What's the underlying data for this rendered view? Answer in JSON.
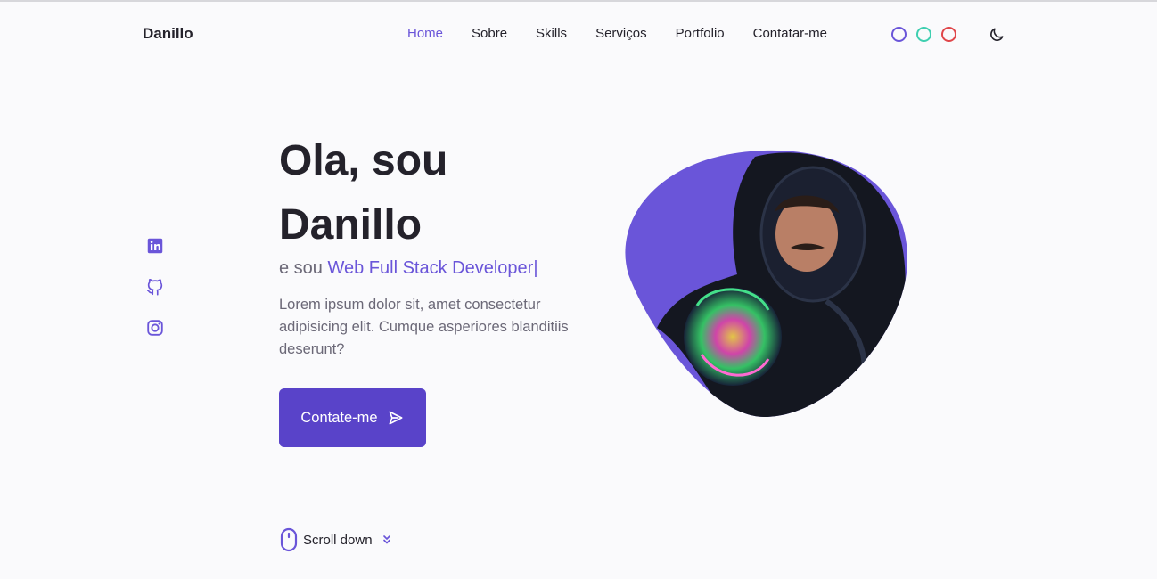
{
  "header": {
    "logo": "Danillo",
    "nav": [
      {
        "label": "Home",
        "active": true
      },
      {
        "label": "Sobre",
        "active": false
      },
      {
        "label": "Skills",
        "active": false
      },
      {
        "label": "Serviços",
        "active": false
      },
      {
        "label": "Portfolio",
        "active": false
      },
      {
        "label": "Contatar-me",
        "active": false
      }
    ],
    "theme_colors": [
      "#6a55d9",
      "#3fcfb0",
      "#e0464a"
    ]
  },
  "social": [
    "linkedin-icon",
    "github-icon",
    "instagram-icon"
  ],
  "hero": {
    "title_line1": "Ola, sou",
    "title_line2": "Danillo",
    "sub_prefix": "e sou ",
    "sub_role": "Web Full Stack Developer|",
    "description": "Lorem ipsum dolor sit, amet consectetur adipisicing elit. Cumque asperiores blanditiis deserunt?",
    "cta_label": "Contate-me",
    "scroll_label": "Scroll down"
  },
  "colors": {
    "accent": "#6a55d9",
    "button": "#5943c9",
    "text": "#24222b",
    "muted": "#6b6877",
    "background": "#fafafc"
  }
}
